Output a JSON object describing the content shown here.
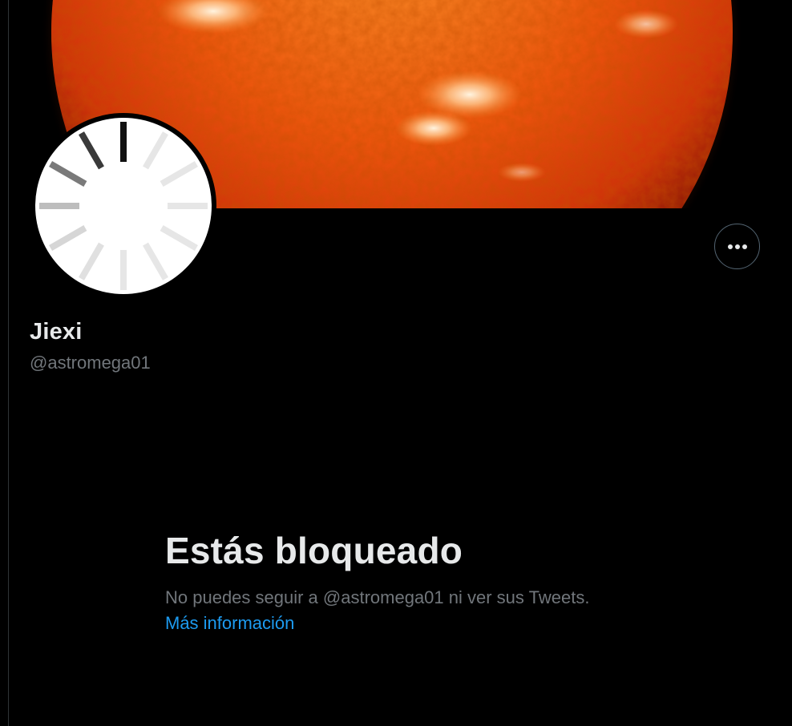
{
  "profile": {
    "display_name": "Jiexi",
    "handle": "@astromega01"
  },
  "banner": {
    "image_subject": "sun-surface"
  },
  "avatar": {
    "image_subject": "loading-spinner"
  },
  "actions": {
    "more_icon": "more-horizontal-icon"
  },
  "blocked_notice": {
    "title": "Estás bloqueado",
    "description": "No puedes seguir a @astromega01 ni ver sus Tweets.",
    "link_label": "Más información"
  },
  "colors": {
    "background": "#000000",
    "primary_text": "#e7e9ea",
    "secondary_text": "#71767b",
    "link": "#1d9bf0",
    "border": "#536471"
  }
}
